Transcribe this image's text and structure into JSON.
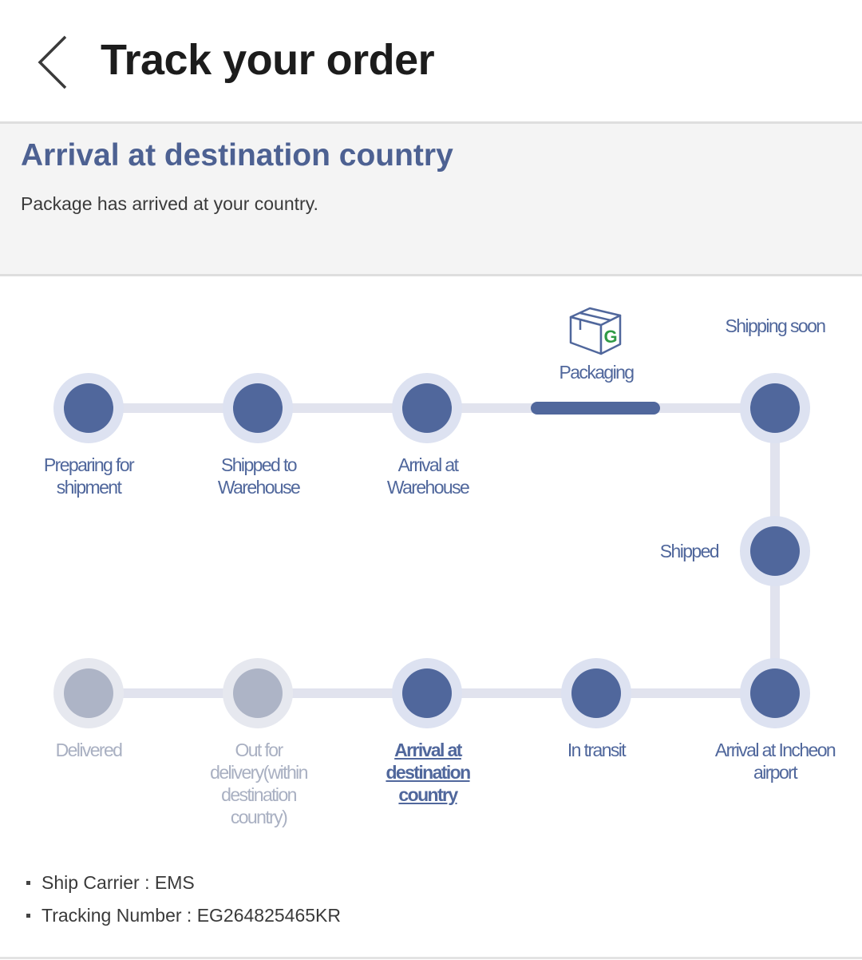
{
  "header": {
    "title": "Track your order"
  },
  "status": {
    "title": "Arrival at destination country",
    "description": "Package has arrived at your country."
  },
  "steps": [
    {
      "label": "Preparing for shipment",
      "state": "done"
    },
    {
      "label": "Shipped to Warehouse",
      "state": "done"
    },
    {
      "label": "Arrival at Warehouse",
      "state": "done"
    },
    {
      "label": "Packaging",
      "state": "done"
    },
    {
      "label": "Shipping soon",
      "state": "done"
    },
    {
      "label": "Shipped",
      "state": "done"
    },
    {
      "label": "Arrival at Incheon airport",
      "state": "done"
    },
    {
      "label": "In transit",
      "state": "done"
    },
    {
      "label": "Arrival at destination country",
      "state": "current"
    },
    {
      "label": "Out for delivery(within destination country)",
      "state": "pending"
    },
    {
      "label": "Delivered",
      "state": "pending"
    }
  ],
  "packaging_icon": {
    "name": "box-icon",
    "letter": "G"
  },
  "info": {
    "carrier": "Ship Carrier : EMS",
    "tracking": "Tracking Number : EG264825465KR"
  },
  "colors": {
    "accent": "#50679c",
    "pending": "#adb4c6",
    "ring": "#dde2f1",
    "line": "#e1e3ee"
  }
}
